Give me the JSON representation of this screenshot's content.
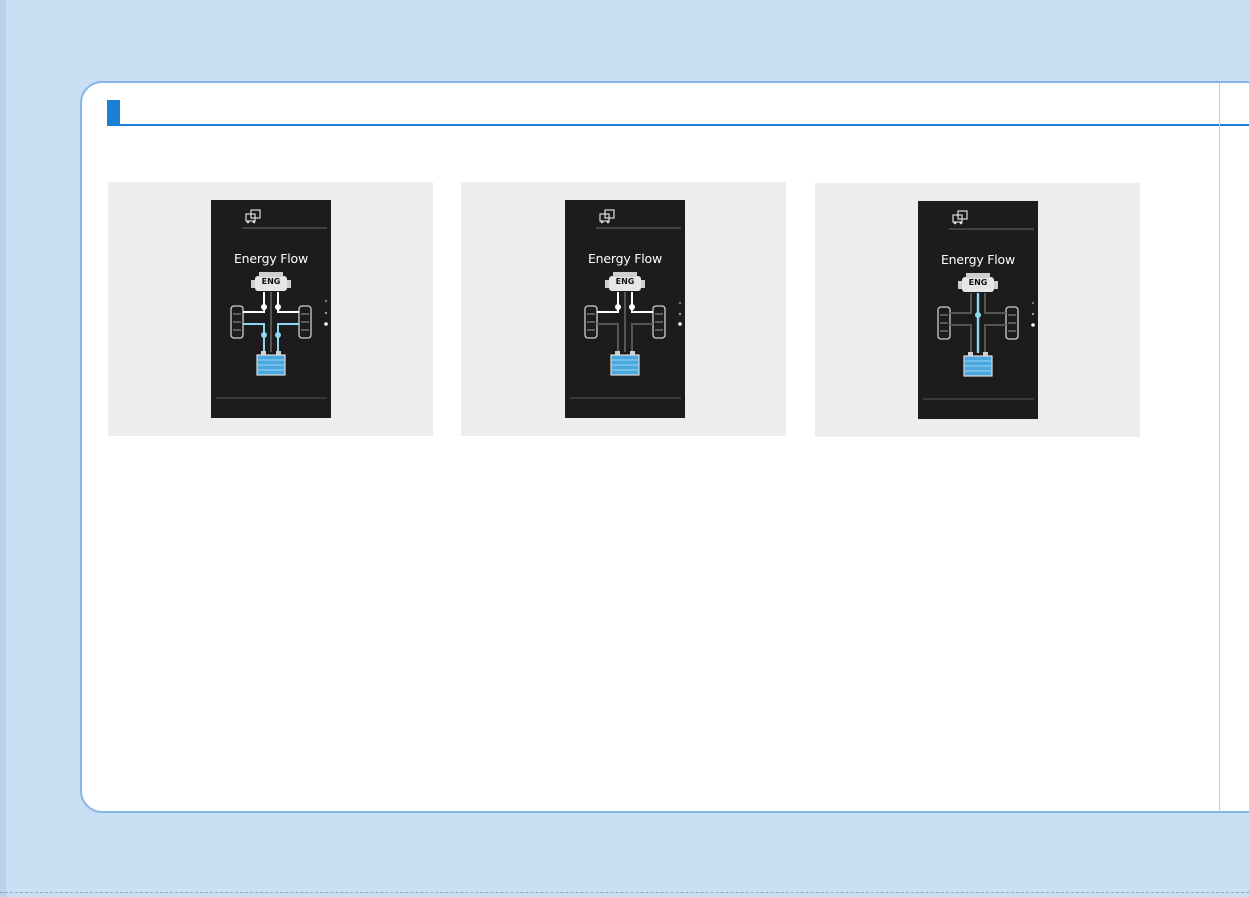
{
  "screens": [
    {
      "title": "Energy Flow",
      "engine_label": "ENG",
      "mode": "battery-charging"
    },
    {
      "title": "Energy Flow",
      "engine_label": "ENG",
      "mode": "engine-drive"
    },
    {
      "title": "Energy Flow",
      "engine_label": "ENG",
      "mode": "engine-charging"
    }
  ],
  "colors": {
    "page_background": "#c9dff3",
    "accent": "#1c7fd4",
    "screen_background": "#1e1b1c",
    "flow_active": "#8fd8f2",
    "flow_inactive": "#555555",
    "battery": "#4aa8de"
  },
  "icons": [
    "car-settings-icon",
    "engine-icon",
    "wheel-icon",
    "battery-icon",
    "page-indicator-dots"
  ]
}
